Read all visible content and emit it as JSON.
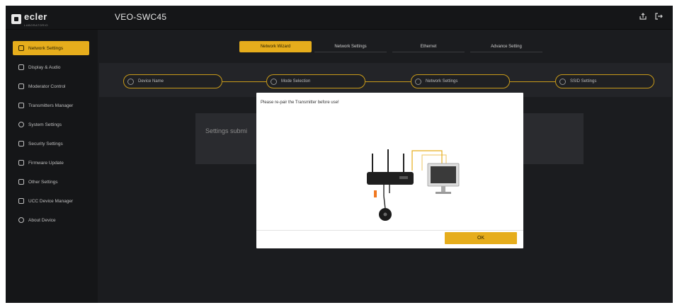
{
  "header": {
    "logo_text": "ecler",
    "logo_subtext": "LABORATORIO",
    "title": "VEO-SWC45",
    "icons": [
      "export-icon",
      "logout-icon"
    ]
  },
  "sidebar": {
    "items": [
      {
        "label": "Network Settings",
        "icon": "person-icon",
        "active": true
      },
      {
        "label": "Display & Audio",
        "icon": "display-icon",
        "active": false
      },
      {
        "label": "Moderator Control",
        "icon": "monitor-icon",
        "active": false
      },
      {
        "label": "Transmitters Manager",
        "icon": "transmitter-icon",
        "active": false
      },
      {
        "label": "System Settings",
        "icon": "gear-icon",
        "active": false
      },
      {
        "label": "Security Settings",
        "icon": "lock-icon",
        "active": false
      },
      {
        "label": "Firmware Update",
        "icon": "update-icon",
        "active": false
      },
      {
        "label": "Other Settings",
        "icon": "settings-icon",
        "active": false
      },
      {
        "label": "UCC Device Manager",
        "icon": "device-icon",
        "active": false
      },
      {
        "label": "About Device",
        "icon": "info-icon",
        "active": false
      }
    ]
  },
  "tabs": [
    {
      "label": "Network Wizard",
      "active": true
    },
    {
      "label": "Network Settings",
      "active": false
    },
    {
      "label": "Ethernet",
      "active": false
    },
    {
      "label": "Advance Setting",
      "active": false
    }
  ],
  "steps": [
    {
      "label": "Device Name"
    },
    {
      "label": "Mode Selection"
    },
    {
      "label": "Network Settings"
    },
    {
      "label": "SSID Settings"
    }
  ],
  "background_card": {
    "text": "Settings submi"
  },
  "modal": {
    "message": "Please re-pair the Transmitter before use!",
    "ok_label": "OK"
  },
  "colors": {
    "accent": "#e6ad1c",
    "background": "#1b1c1f",
    "sidebar": "#151618"
  }
}
